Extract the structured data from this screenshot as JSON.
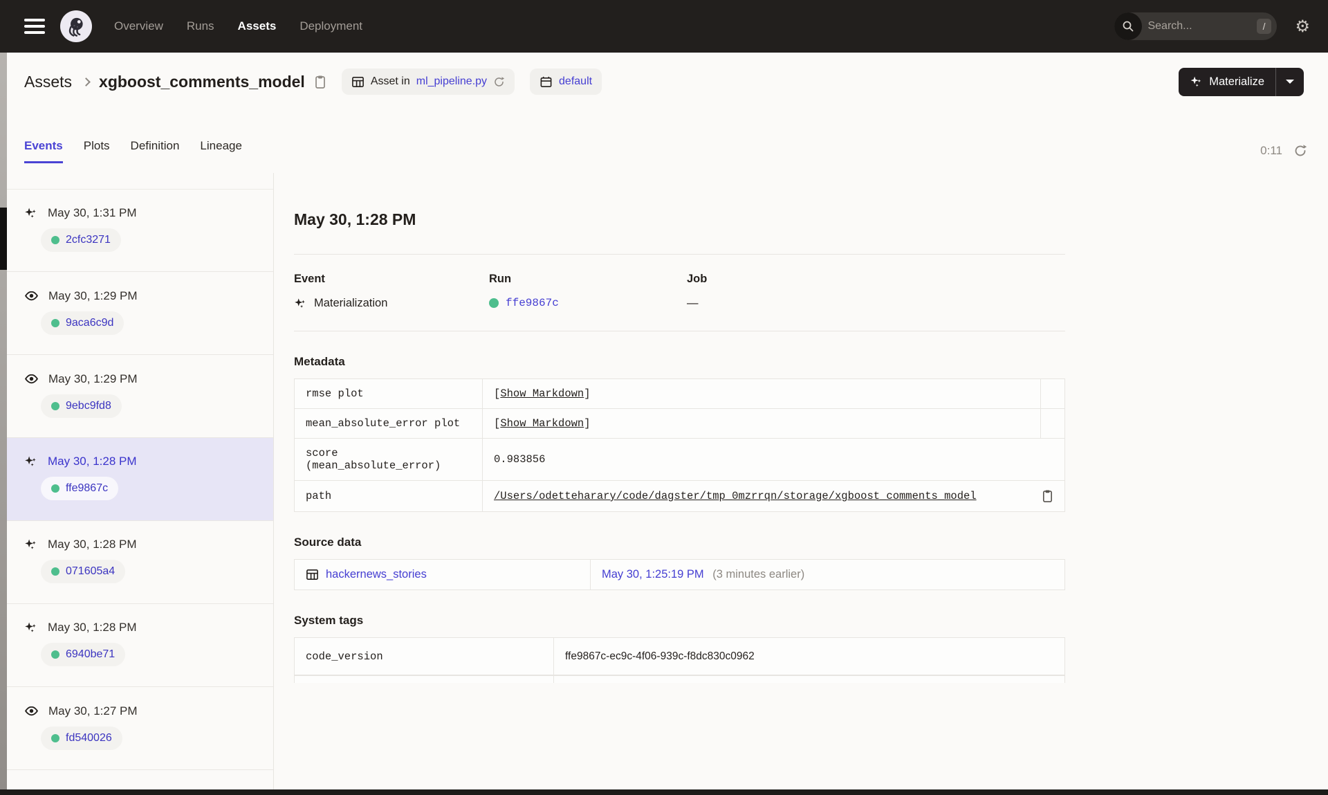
{
  "nav": {
    "links": [
      {
        "label": "Overview",
        "active": false
      },
      {
        "label": "Runs",
        "active": false
      },
      {
        "label": "Assets",
        "active": true
      },
      {
        "label": "Deployment",
        "active": false
      }
    ],
    "search_placeholder": "Search...",
    "search_shortcut": "/",
    "gear_glyph": "⚙"
  },
  "header": {
    "breadcrumb_root": "Assets",
    "title": "xgboost_comments_model",
    "asset_in_label": "Asset in",
    "asset_file_link": "ml_pipeline.py",
    "repo_badge": "default",
    "materialize_label": "Materialize"
  },
  "tabs": {
    "items": [
      {
        "label": "Events",
        "active": true
      },
      {
        "label": "Plots",
        "active": false
      },
      {
        "label": "Definition",
        "active": false
      },
      {
        "label": "Lineage",
        "active": false
      }
    ],
    "timer": "0:11"
  },
  "sidebar": {
    "events": [
      {
        "type": "materialization",
        "time": "May 30, 1:31 PM",
        "run_id": "2cfc3271",
        "selected": false
      },
      {
        "type": "observation",
        "time": "May 30, 1:29 PM",
        "run_id": "9aca6c9d",
        "selected": false
      },
      {
        "type": "observation",
        "time": "May 30, 1:29 PM",
        "run_id": "9ebc9fd8",
        "selected": false
      },
      {
        "type": "materialization",
        "time": "May 30, 1:28 PM",
        "run_id": "ffe9867c",
        "selected": true
      },
      {
        "type": "materialization",
        "time": "May 30, 1:28 PM",
        "run_id": "071605a4",
        "selected": false
      },
      {
        "type": "materialization",
        "time": "May 30, 1:28 PM",
        "run_id": "6940be71",
        "selected": false
      },
      {
        "type": "observation",
        "time": "May 30, 1:27 PM",
        "run_id": "fd540026",
        "selected": false
      }
    ]
  },
  "detail": {
    "heading": "May 30, 1:28 PM",
    "event_label": "Event",
    "event_value": "Materialization",
    "run_label": "Run",
    "run_value": "ffe9867c",
    "job_label": "Job",
    "job_value": "—",
    "metadata": {
      "title": "Metadata",
      "rows": [
        {
          "key": "rmse plot",
          "prefix": "[",
          "link": "Show Markdown",
          "suffix": "]"
        },
        {
          "key": "mean_absolute_error plot",
          "prefix": "[",
          "link": "Show Markdown",
          "suffix": "]"
        },
        {
          "key": "score (mean_absolute_error)",
          "value": "0.983856"
        },
        {
          "key": "path",
          "value": "/Users/odetteharary/code/dagster/tmp_0mzrrqn/storage/xgboost_comments_model"
        }
      ]
    },
    "source_data": {
      "title": "Source data",
      "asset_link": "hackernews_stories",
      "time_link": "May 30, 1:25:19 PM",
      "time_note": "(3 minutes earlier)"
    },
    "system_tags": {
      "title": "System tags",
      "rows": [
        {
          "key": "code_version",
          "value": "ffe9867c-ec9c-4f06-939c-f8dc830c0962"
        }
      ]
    }
  },
  "colors": {
    "nav_bg": "#221f1d",
    "link_indigo": "#453ed2",
    "success_green": "#4ebe8d",
    "selected_lavender": "#e7e5f6",
    "dark_button": "#231f20"
  }
}
